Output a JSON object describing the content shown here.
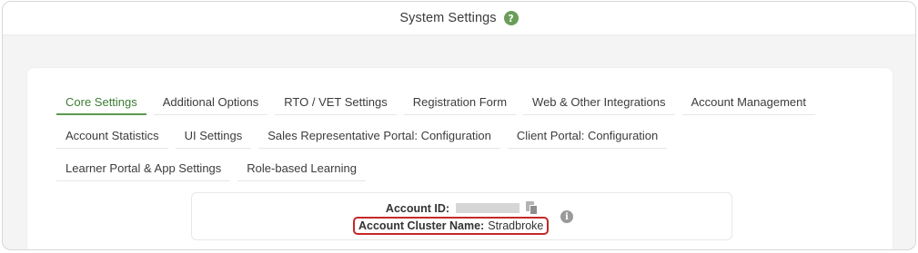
{
  "header": {
    "title": "System Settings",
    "help_icon": "question-circle-icon"
  },
  "tabs": {
    "row1": [
      "Core Settings",
      "Additional Options",
      "RTO / VET Settings",
      "Registration Form",
      "Web & Other Integrations",
      "Account Management"
    ],
    "row2": [
      "Account Statistics",
      "UI Settings",
      "Sales Representative Portal: Configuration",
      "Client Portal: Configuration"
    ],
    "row3": [
      "Learner Portal & App Settings",
      "Role-based Learning"
    ],
    "active": "Core Settings"
  },
  "account": {
    "id_label": "Account ID:",
    "cluster_label": "Account Cluster Name:",
    "cluster_value": "Stradbroke"
  },
  "colors": {
    "accent": "#5b9a4f",
    "highlight_border": "#c62828"
  }
}
